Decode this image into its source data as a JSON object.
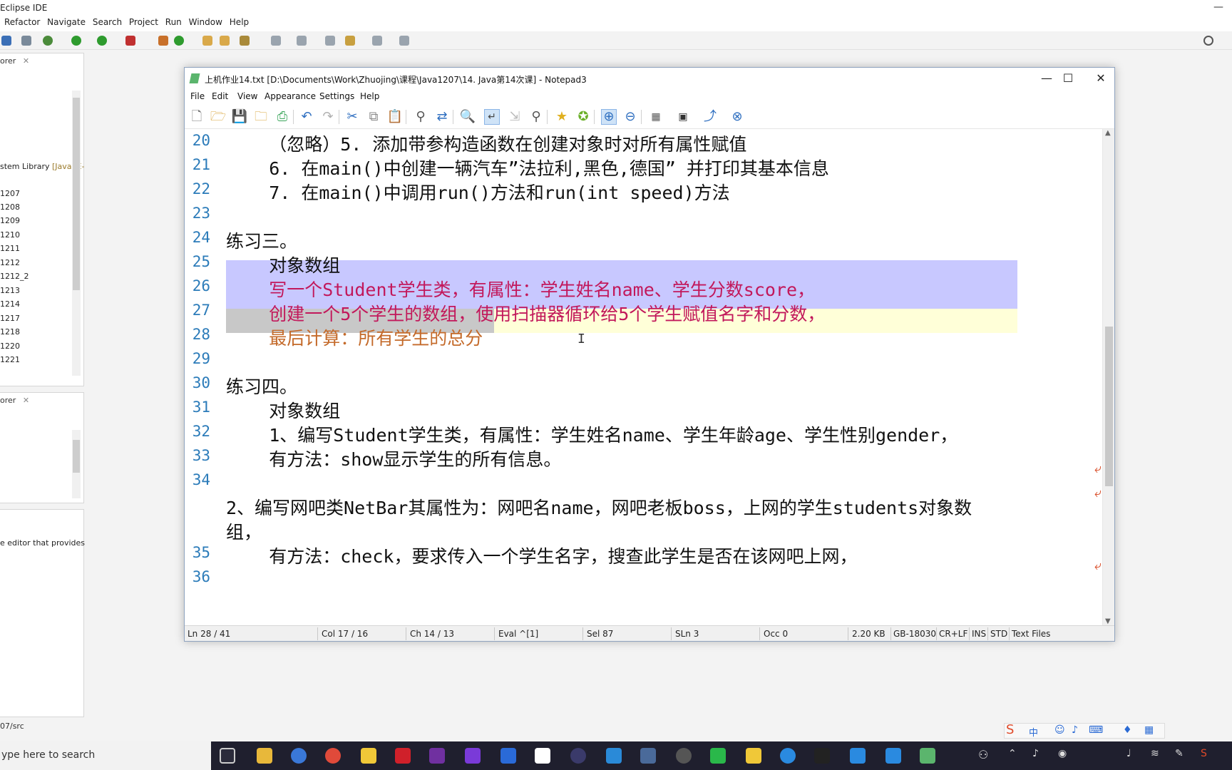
{
  "eclipse": {
    "title": "Eclipse IDE",
    "menu": [
      "Refactor",
      "Navigate",
      "Search",
      "Project",
      "Run",
      "Window",
      "Help"
    ],
    "panel1_tab": "orer",
    "panel1_items": [
      "stem Library",
      "[JavaSE-",
      "1207",
      "1208",
      "1209",
      "1210",
      "1211",
      "1212",
      "1212_2",
      "1213",
      "1214",
      "1217",
      "1218",
      "1220",
      "1221"
    ],
    "panel2_tab": "orer",
    "panel3_text": "e editor that provides",
    "status_path": "07/src"
  },
  "notepad": {
    "title": "上机作业14.txt [D:\\Documents\\Work\\Zhuojing\\课程\\Java1207\\14. Java第14次课] - Notepad3",
    "menu": [
      "File",
      "Edit",
      "View",
      "Appearance",
      "Settings",
      "Help"
    ],
    "lines": [
      {
        "n": "20",
        "text": "    （忽略）5. 添加带参构造函数在创建对象时对所有属性赋值"
      },
      {
        "n": "21",
        "text": "    6. 在main()中创建一辆汽车”法拉利,黑色,德国” 并打印其基本信息"
      },
      {
        "n": "22",
        "text": "    7. 在main()中调用run()方法和run(int speed)方法"
      },
      {
        "n": "23",
        "text": ""
      },
      {
        "n": "24",
        "text": "练习三。"
      },
      {
        "n": "25",
        "text": "    对象数组"
      },
      {
        "n": "26",
        "text": "    写一个Student学生类，有属性：学生姓名name、学生分数score，"
      },
      {
        "n": "27",
        "text": "    创建一个5个学生的数组，使用扫描器循环给5个学生赋值名字和分数，"
      },
      {
        "n": "28",
        "text": "    最后计算：所有学生的总分"
      },
      {
        "n": "29",
        "text": ""
      },
      {
        "n": "30",
        "text": "练习四。"
      },
      {
        "n": "31",
        "text": "    对象数组"
      },
      {
        "n": "32",
        "text": "    1、编写Student学生类，有属性：学生姓名name、学生年龄age、学生性别gender，"
      },
      {
        "n": "33",
        "text": "    有方法：show显示学生的所有信息。"
      },
      {
        "n": "34",
        "text": ""
      },
      {
        "n": "",
        "text": "2、编写网吧类NetBar其属性为：网吧名name，网吧老板boss，上网的学生students对象数"
      },
      {
        "n": "",
        "text": "组，"
      },
      {
        "n": "35",
        "text": "    有方法：check，要求传入一个学生名字，搜查此学生是否在该网吧上网，"
      },
      {
        "n": "36",
        "text": ""
      }
    ],
    "status": {
      "ln": "Ln 28 / 41",
      "col": "Col 17 / 16",
      "ch": "Ch 14 / 13",
      "eval": "Eval ^[1]",
      "sel": "Sel 87",
      "sln": "SLn 3",
      "occ": "Occ 0",
      "size": "2.20 KB",
      "enc": "GB-18030",
      "eol": "CR+LF",
      "ins": "INS",
      "std": "STD",
      "type": "Text Files"
    }
  },
  "taskbar": {
    "search_placeholder": "ype here to search"
  }
}
